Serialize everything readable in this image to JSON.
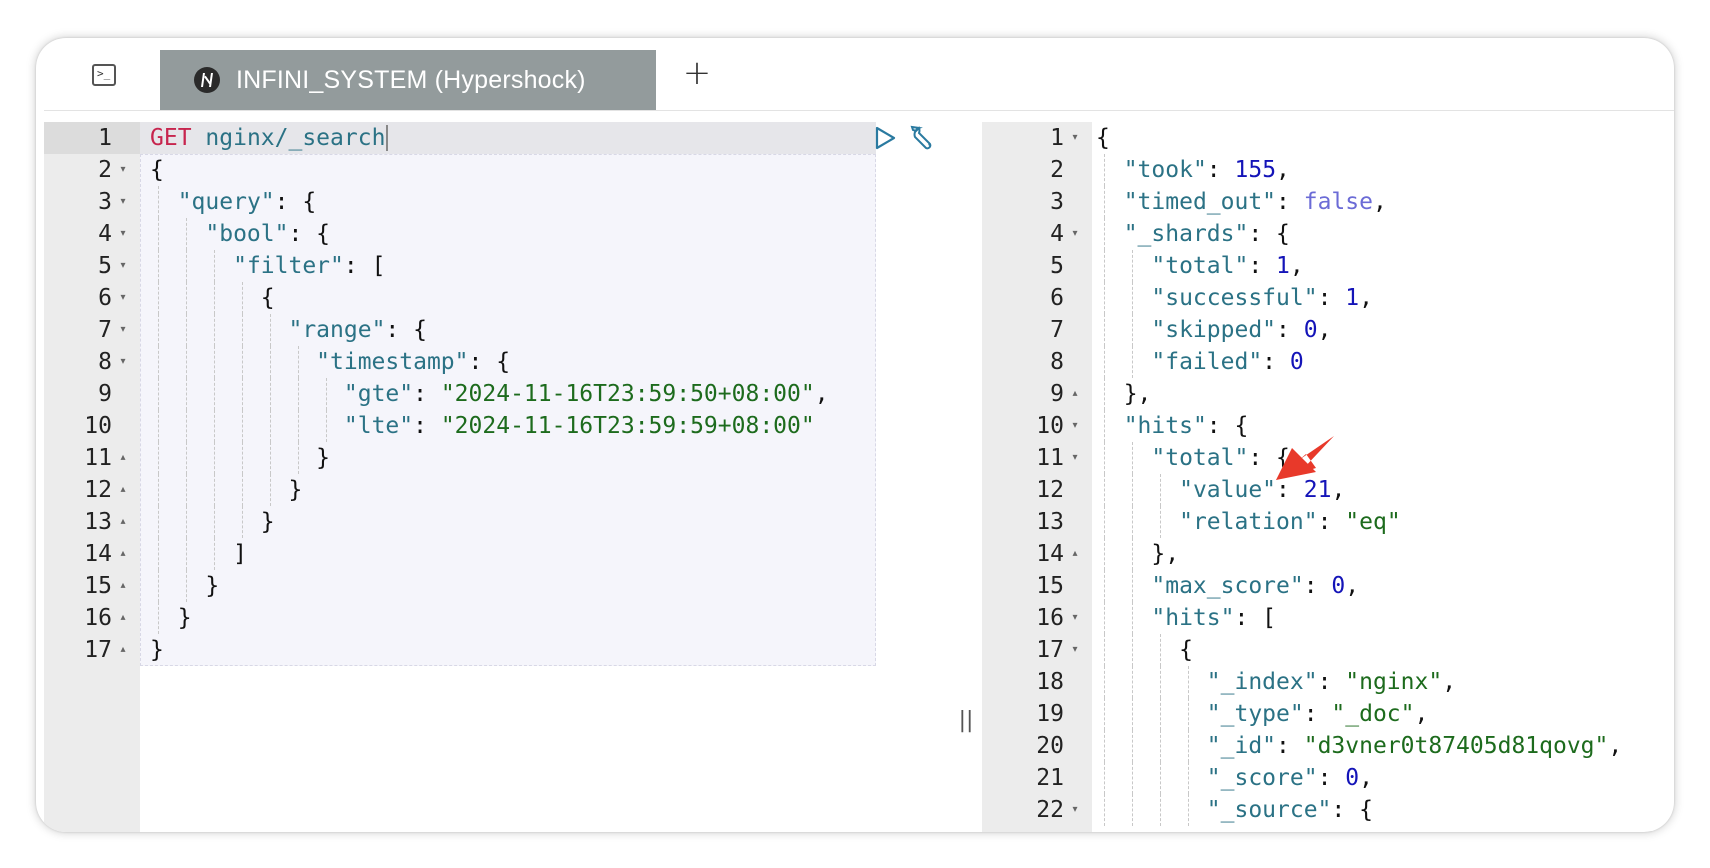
{
  "tabbar": {
    "console_icon": "terminal-icon",
    "console_glyph": ">_",
    "tab_label": "INFINI_SYSTEM (Hypershock)",
    "tab_icon": "cluster-logo-icon",
    "add_glyph": "+"
  },
  "request": {
    "method": "GET",
    "path": "nginx/_search",
    "line_numbers": [
      "1",
      "2",
      "3",
      "4",
      "5",
      "6",
      "7",
      "8",
      "9",
      "10",
      "11",
      "12",
      "13",
      "14",
      "15",
      "16",
      "17"
    ],
    "body_lines": [
      "{",
      "  \"query\": {",
      "    \"bool\": {",
      "      \"filter\": [",
      "        {",
      "          \"range\": {",
      "            \"timestamp\": {",
      "              \"gte\": \"2024-11-16T23:59:50+08:00\",",
      "              \"lte\": \"2024-11-16T23:59:59+08:00\"",
      "            }",
      "          }",
      "        }",
      "      ]",
      "    }",
      "  }",
      "}"
    ]
  },
  "response": {
    "line_numbers": [
      "1",
      "2",
      "3",
      "4",
      "5",
      "6",
      "7",
      "8",
      "9",
      "10",
      "11",
      "12",
      "13",
      "14",
      "15",
      "16",
      "17",
      "18",
      "19",
      "20",
      "21",
      "22"
    ],
    "lines": [
      "{",
      "  \"took\": 155,",
      "  \"timed_out\": false,",
      "  \"_shards\": {",
      "    \"total\": 1,",
      "    \"successful\": 1,",
      "    \"skipped\": 0,",
      "    \"failed\": 0",
      "  },",
      "  \"hits\": {",
      "    \"total\": {",
      "      \"value\": 21,",
      "      \"relation\": \"eq\"",
      "    },",
      "    \"max_score\": 0,",
      "    \"hits\": [",
      "      {",
      "        \"_index\": \"nginx\",",
      "        \"_type\": \"_doc\",",
      "        \"_id\": \"d3vner0t87405d81qovg\",",
      "        \"_score\": 0,",
      "        \"_source\": {"
    ]
  },
  "annotation": {
    "color": "#e8392a"
  },
  "colors": {
    "key": "#2b7285",
    "string": "#1d6b1d",
    "number": "#1414b8",
    "bool": "#6b6bd6",
    "method": "#c7254e"
  }
}
